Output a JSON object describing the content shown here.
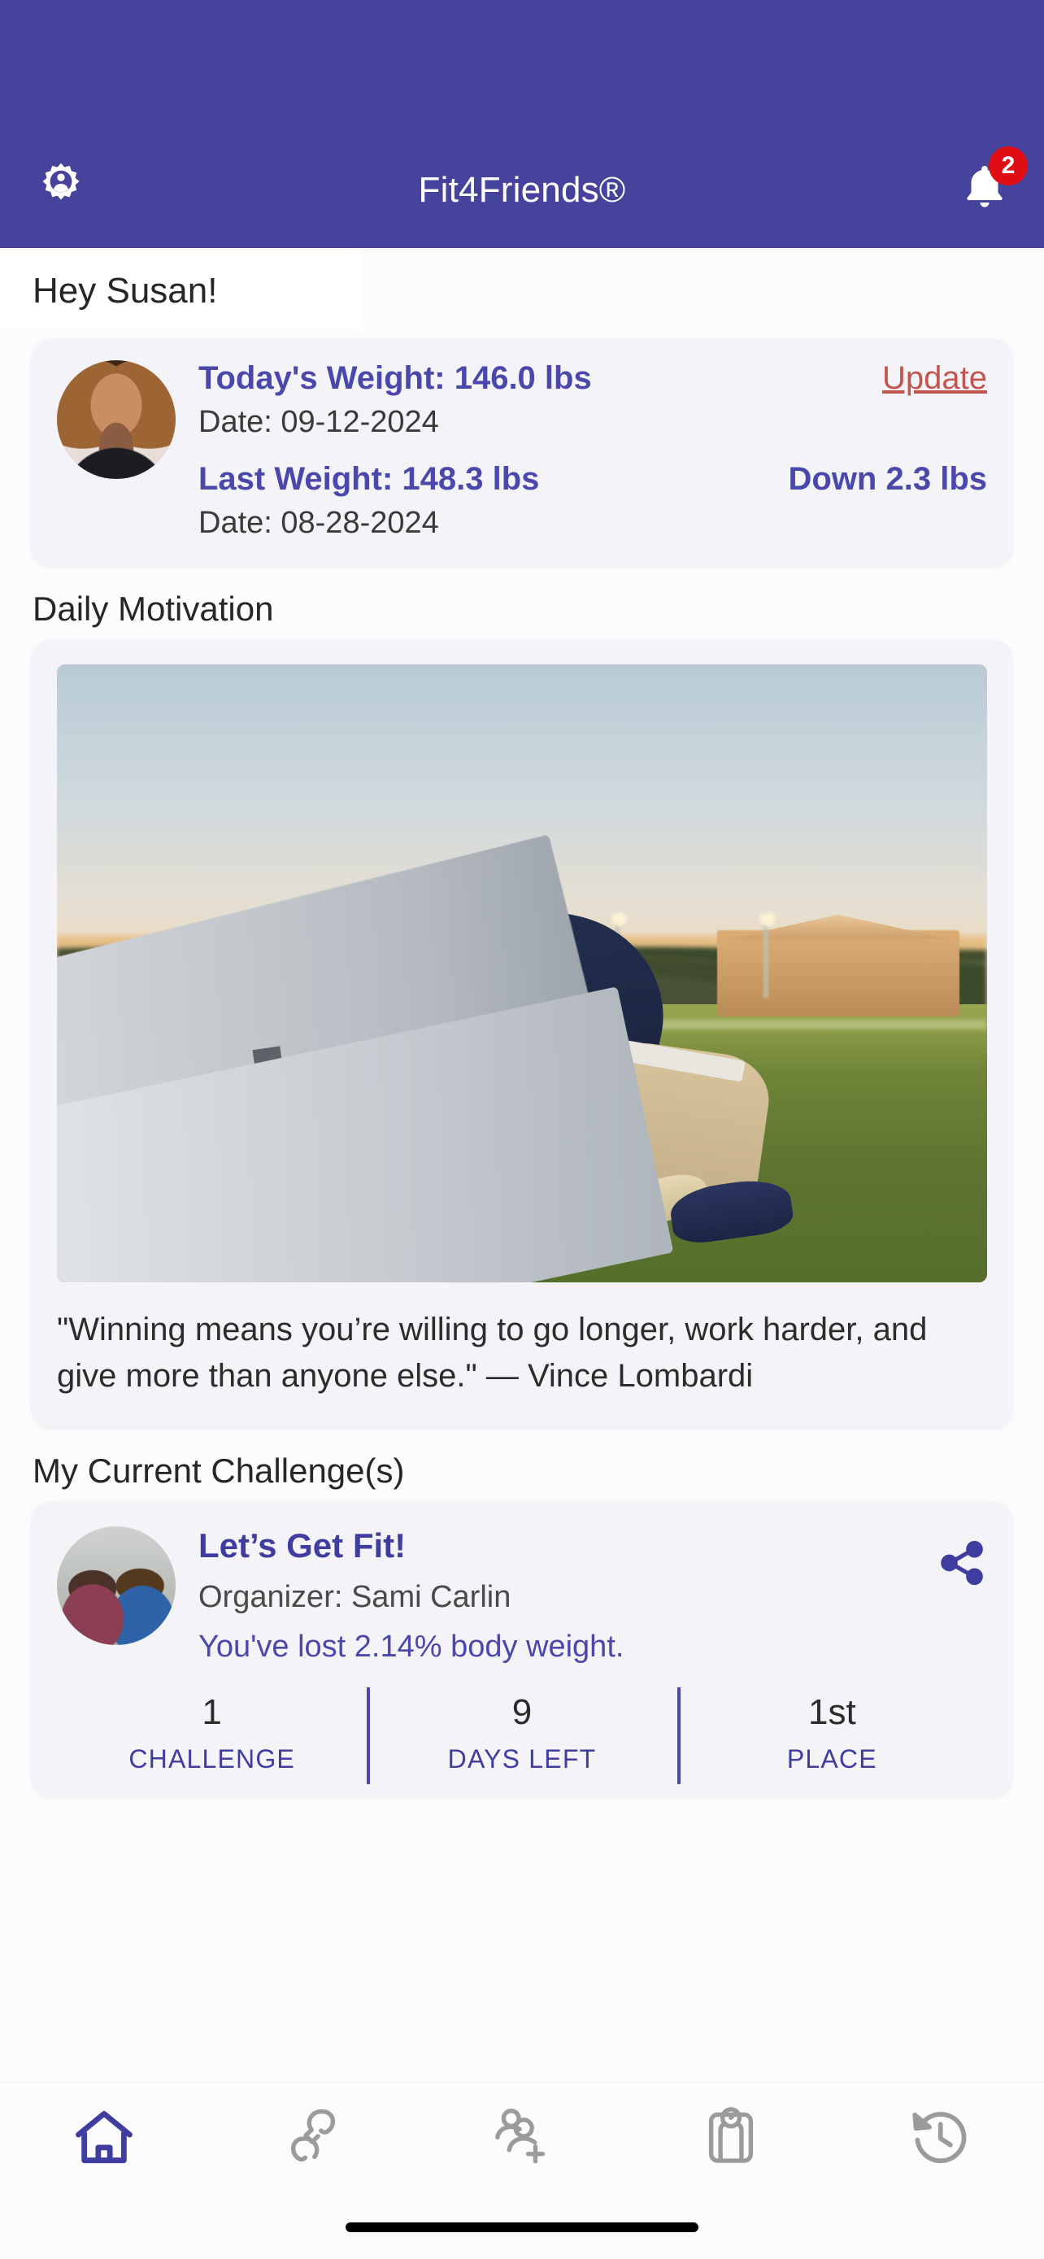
{
  "header": {
    "title": "Fit4Friends®",
    "account_icon": "gear-person-icon",
    "notifications_icon": "bell-icon",
    "notification_count": "2",
    "bar_color": "#45439b",
    "badge_color": "#e10d15"
  },
  "greeting": "Hey Susan!",
  "weight_card": {
    "avatar": "user-avatar",
    "today_label": "Today's Weight: 146.0 lbs",
    "today_date": "Date: 09-12-2024",
    "update_label": "Update",
    "last_label": "Last Weight: 148.3 lbs",
    "last_date": "Date: 08-28-2024",
    "delta_label": "Down 2.3 lbs",
    "accent_color": "#4a48ab",
    "link_color": "#c2564e"
  },
  "motivation": {
    "section_title": "Daily Motivation",
    "image_alt": "football-player-kneeling-at-bench",
    "quote": "\"Winning means you’re willing to go longer, work harder, and give more than anyone else.\" — Vince Lombardi"
  },
  "challenges": {
    "section_title": "My Current Challenge(s)",
    "card": {
      "avatar": "challenge-group-photo",
      "title": "Let’s Get Fit!",
      "organizer": "Organizer: Sami Carlin",
      "progress": "You've lost 2.14% body weight.",
      "share_icon": "share-icon",
      "stats": [
        {
          "value": "1",
          "label": "CHALLENGE"
        },
        {
          "value": "9",
          "label": "DAYS LEFT"
        },
        {
          "value": "1st",
          "label": "PLACE"
        }
      ]
    }
  },
  "bottom_nav": {
    "items": [
      {
        "name": "home-icon",
        "active": true
      },
      {
        "name": "boxing-gloves-icon",
        "active": false
      },
      {
        "name": "add-friends-icon",
        "active": false
      },
      {
        "name": "weight-scale-icon",
        "active": false
      },
      {
        "name": "history-clock-icon",
        "active": false
      }
    ],
    "active_color": "#3f3da0",
    "inactive_color": "#9b9b9b"
  }
}
